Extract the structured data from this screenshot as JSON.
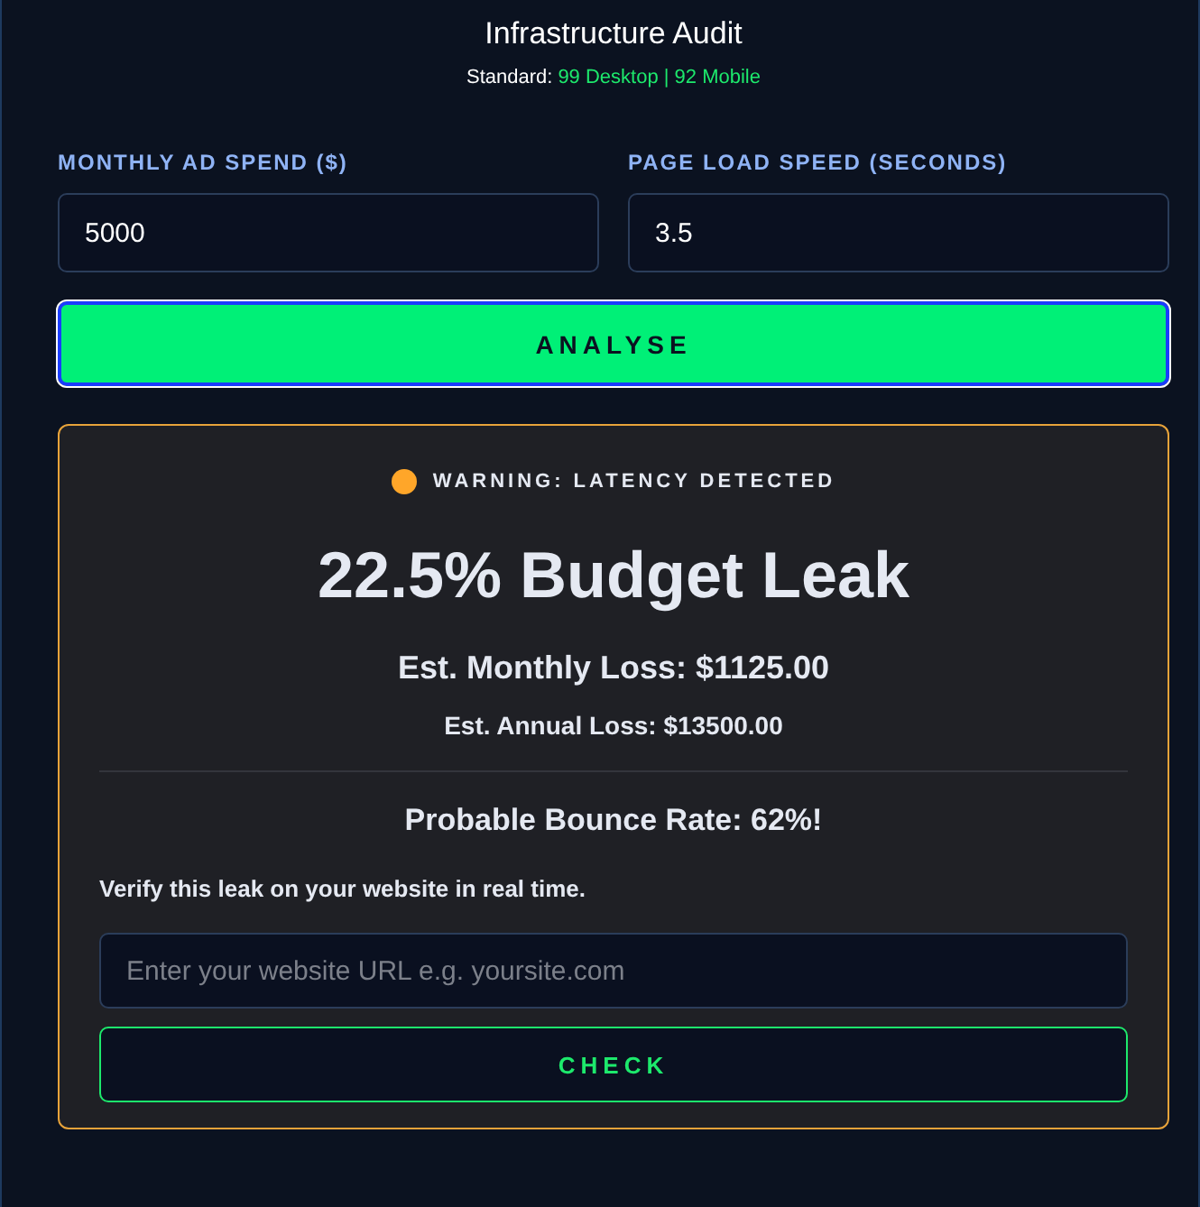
{
  "header": {
    "title": "Infrastructure Audit",
    "standard_label": "Standard:",
    "standard_value": "99 Desktop | 92 Mobile"
  },
  "fields": [
    {
      "label": "MONTHLY AD SPEND ($)",
      "value": "5000"
    },
    {
      "label": "PAGE LOAD SPEED (SECONDS)",
      "value": "3.5"
    }
  ],
  "analyse_button": {
    "label": "ANALYSE",
    "focused": true
  },
  "result": {
    "status": {
      "label": "WARNING: LATENCY DETECTED",
      "color": "#ffa629"
    },
    "headline": "22.5% Budget Leak",
    "monthly_loss": "Est. Monthly Loss: $1125.00",
    "annual_loss": "Est. Annual Loss: $13500.00",
    "bounce_rate": "Probable Bounce Rate: 62%!",
    "verify_text": "Verify this leak on your website in real time.",
    "url_field": {
      "placeholder": "Enter your website URL e.g. yoursite.com"
    },
    "check_button": {
      "label": "CHECK"
    }
  }
}
